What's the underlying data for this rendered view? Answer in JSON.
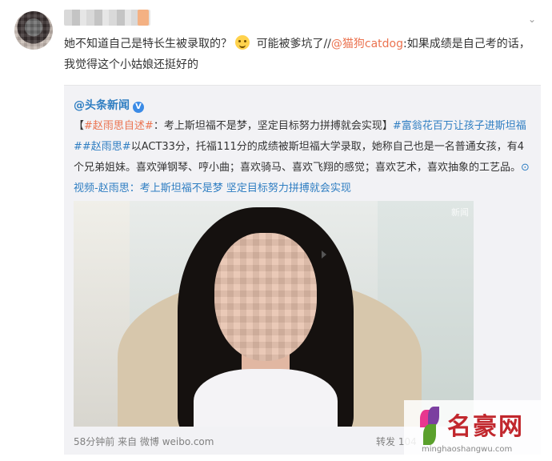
{
  "post": {
    "text_part1": "她不知道自己是特长生被录取的？",
    "text_part2": " 可能被爹坑了//",
    "mention": "@猫狗catdog",
    "text_part3": ":如果成绩是自己考的话，我觉得这个小姑娘还挺好的"
  },
  "repost": {
    "author": "@头条新闻",
    "verified_badge": "V",
    "topic1": "#赵雨思自述#",
    "headline": "：考上斯坦福不是梦，坚定目标努力拼搏就会实现】",
    "bracket_open": "【",
    "topic2": "#富翁花百万让孩子进斯坦福#",
    "topic3": "#赵雨思#",
    "body": "以ACT33分，托福111分的成绩被斯坦福大学录取，她称自己也是一名普通女孩，有4个兄弟姐妹。喜欢弹钢琴、哼小曲；喜欢骑马、喜欢飞翔的感觉；喜欢艺术，喜欢抽象的工艺品。",
    "video_link": "⊙视频-赵雨思：考上斯坦福不是梦 坚定目标努力拼搏就会实现",
    "video_watermark": "新闻",
    "time": "58分钟前",
    "from_label": " 来自 ",
    "source": "微博 weibo.com",
    "repost_label": "转发 104",
    "caret": "⌄"
  },
  "brand": {
    "name": "名豪网",
    "domain": "minghaoshangwu.com"
  },
  "colors": {
    "mention": "#eb7350",
    "topic": "#2f7ec2",
    "background": "#ffffff",
    "repost_bg": "#f2f2f5",
    "brand": "#c1272d"
  }
}
